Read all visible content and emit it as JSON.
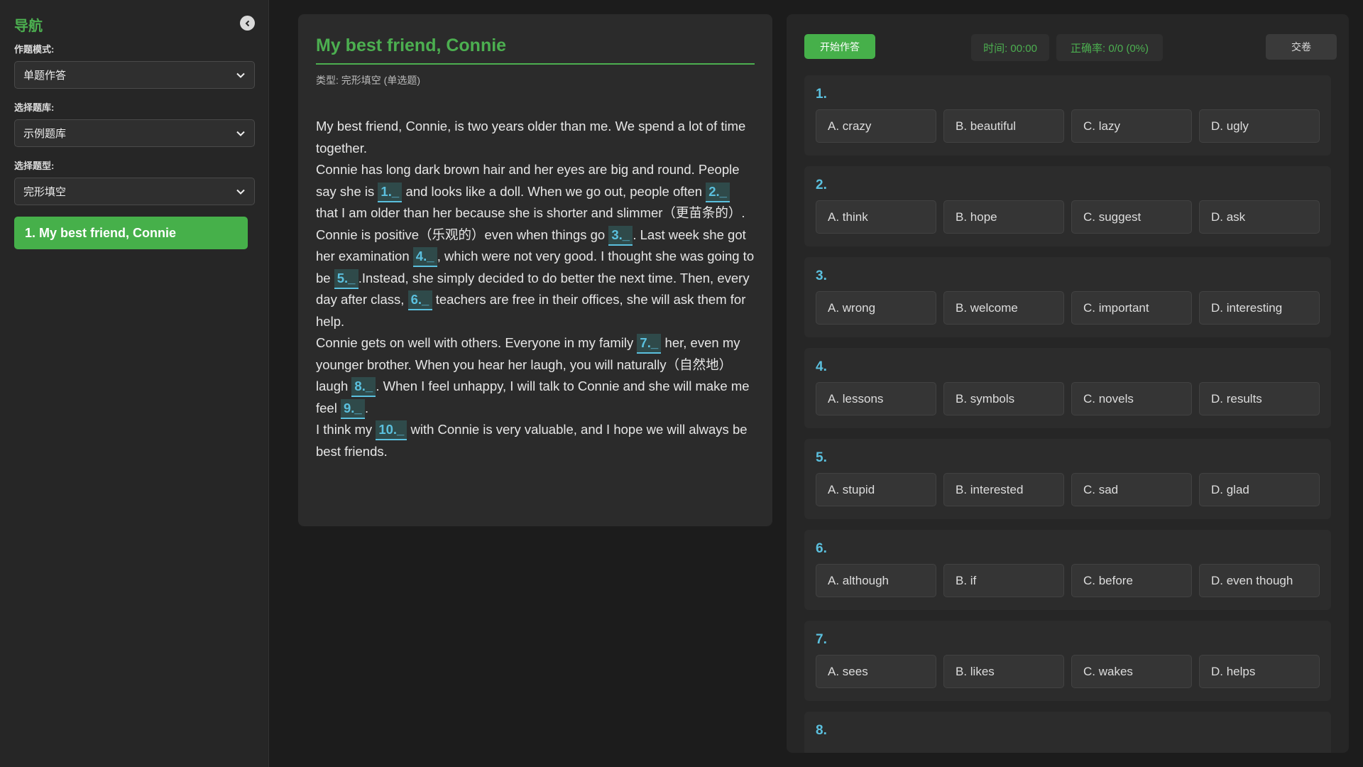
{
  "sidebar": {
    "title": "导航",
    "mode_label": "作题模式:",
    "mode_value": "单题作答",
    "bank_label": "选择题库:",
    "bank_value": "示例题库",
    "type_label": "选择题型:",
    "type_value": "完形填空",
    "items": [
      {
        "label": "1. My best friend, Connie"
      }
    ]
  },
  "passage": {
    "title": "My best friend, Connie",
    "type_line": "类型: 完形填空 (单选题)",
    "paragraphs": [
      [
        "My best friend, Connie, is two years older than me. We spend a lot of time together."
      ],
      [
        "Connie has long dark brown hair and her eyes are big and round. People say she is ",
        {
          "blank": "1._"
        },
        " and looks like a doll. When we go out, people often ",
        {
          "blank": "2._"
        },
        " that I am older than her because she is shorter and slimmer（更苗条的）."
      ],
      [
        "Connie is positive（乐观的）even when things go ",
        {
          "blank": "3._"
        },
        ". Last week she got her examination ",
        {
          "blank": "4._"
        },
        ", which were not very good. I thought she was going to be ",
        {
          "blank": "5._"
        },
        ".Instead, she simply decided to do better the next time. Then, every day after class, ",
        {
          "blank": "6._"
        },
        " teachers are free in their offices, she will ask them for help."
      ],
      [
        "Connie gets on well with others. Everyone in my family ",
        {
          "blank": "7._"
        },
        " her, even my younger brother. When you hear her laugh, you will naturally（自然地）laugh ",
        {
          "blank": "8._"
        },
        ". When I feel unhappy, I will talk to Connie and she will make me feel ",
        {
          "blank": "9._"
        },
        "."
      ],
      [
        "I think my ",
        {
          "blank": "10._"
        },
        " with Connie is very valuable, and I hope we will always be best friends."
      ]
    ]
  },
  "toolbar": {
    "start_label": "开始作答",
    "time_text": "时间: 00:00",
    "accuracy_text": "正确率: 0/0 (0%)",
    "submit_label": "交卷"
  },
  "questions": [
    {
      "num": "1.",
      "options": [
        "A. crazy",
        "B. beautiful",
        "C. lazy",
        "D. ugly"
      ]
    },
    {
      "num": "2.",
      "options": [
        "A. think",
        "B. hope",
        "C. suggest",
        "D. ask"
      ]
    },
    {
      "num": "3.",
      "options": [
        "A. wrong",
        "B. welcome",
        "C. important",
        "D. interesting"
      ]
    },
    {
      "num": "4.",
      "options": [
        "A. lessons",
        "B. symbols",
        "C. novels",
        "D. results"
      ]
    },
    {
      "num": "5.",
      "options": [
        "A. stupid",
        "B. interested",
        "C. sad",
        "D. glad"
      ]
    },
    {
      "num": "6.",
      "options": [
        "A. although",
        "B. if",
        "C. before",
        "D. even though"
      ]
    },
    {
      "num": "7.",
      "options": [
        "A. sees",
        "B. likes",
        "C. wakes",
        "D. helps"
      ]
    },
    {
      "num": "8.",
      "options": []
    }
  ],
  "colors": {
    "accent_green": "#4caf50",
    "blank_blue": "#5bc0de",
    "background": "#1c1c1c"
  },
  "icons": {
    "collapse": "chevron-left-circle-icon",
    "select": "chevron-down-icon"
  }
}
